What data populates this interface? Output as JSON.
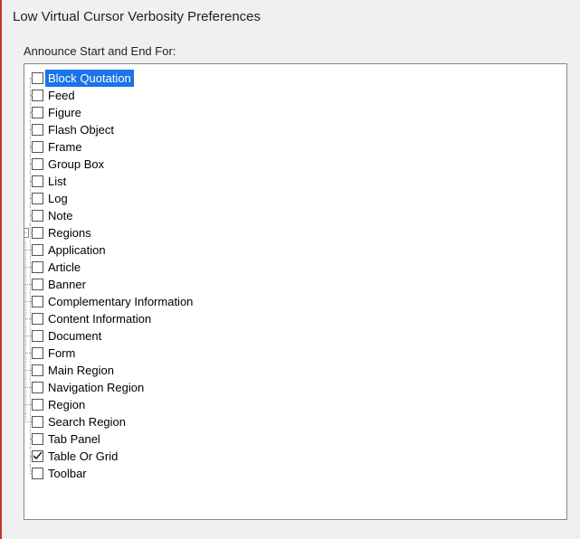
{
  "window": {
    "title": "Low Virtual Cursor Verbosity Preferences",
    "section_label": "Announce Start and End For:"
  },
  "toggle_glyph": {
    "expanded": "−",
    "collapsed": "+"
  },
  "tree": [
    {
      "id": "block-quotation",
      "label": "Block Quotation",
      "checked": false,
      "selected": true
    },
    {
      "id": "feed",
      "label": "Feed",
      "checked": false
    },
    {
      "id": "figure",
      "label": "Figure",
      "checked": false
    },
    {
      "id": "flash-object",
      "label": "Flash Object",
      "checked": false
    },
    {
      "id": "frame",
      "label": "Frame",
      "checked": false
    },
    {
      "id": "group-box",
      "label": "Group Box",
      "checked": false
    },
    {
      "id": "list",
      "label": "List",
      "checked": false
    },
    {
      "id": "log",
      "label": "Log",
      "checked": false
    },
    {
      "id": "note",
      "label": "Note",
      "checked": false
    },
    {
      "id": "regions",
      "label": "Regions",
      "checked": false,
      "expanded": true,
      "children": [
        {
          "id": "application",
          "label": "Application",
          "checked": false
        },
        {
          "id": "article",
          "label": "Article",
          "checked": false
        },
        {
          "id": "banner",
          "label": "Banner",
          "checked": false
        },
        {
          "id": "complementary-information",
          "label": "Complementary Information",
          "checked": false
        },
        {
          "id": "content-information",
          "label": "Content Information",
          "checked": false
        },
        {
          "id": "document",
          "label": "Document",
          "checked": false
        },
        {
          "id": "form",
          "label": "Form",
          "checked": false
        },
        {
          "id": "main-region",
          "label": "Main Region",
          "checked": false
        },
        {
          "id": "navigation-region",
          "label": "Navigation Region",
          "checked": false
        },
        {
          "id": "region",
          "label": "Region",
          "checked": false
        },
        {
          "id": "search-region",
          "label": "Search Region",
          "checked": false
        }
      ]
    },
    {
      "id": "tab-panel",
      "label": "Tab Panel",
      "checked": false
    },
    {
      "id": "table-or-grid",
      "label": "Table Or Grid",
      "checked": true
    },
    {
      "id": "toolbar",
      "label": "Toolbar",
      "checked": false
    }
  ]
}
